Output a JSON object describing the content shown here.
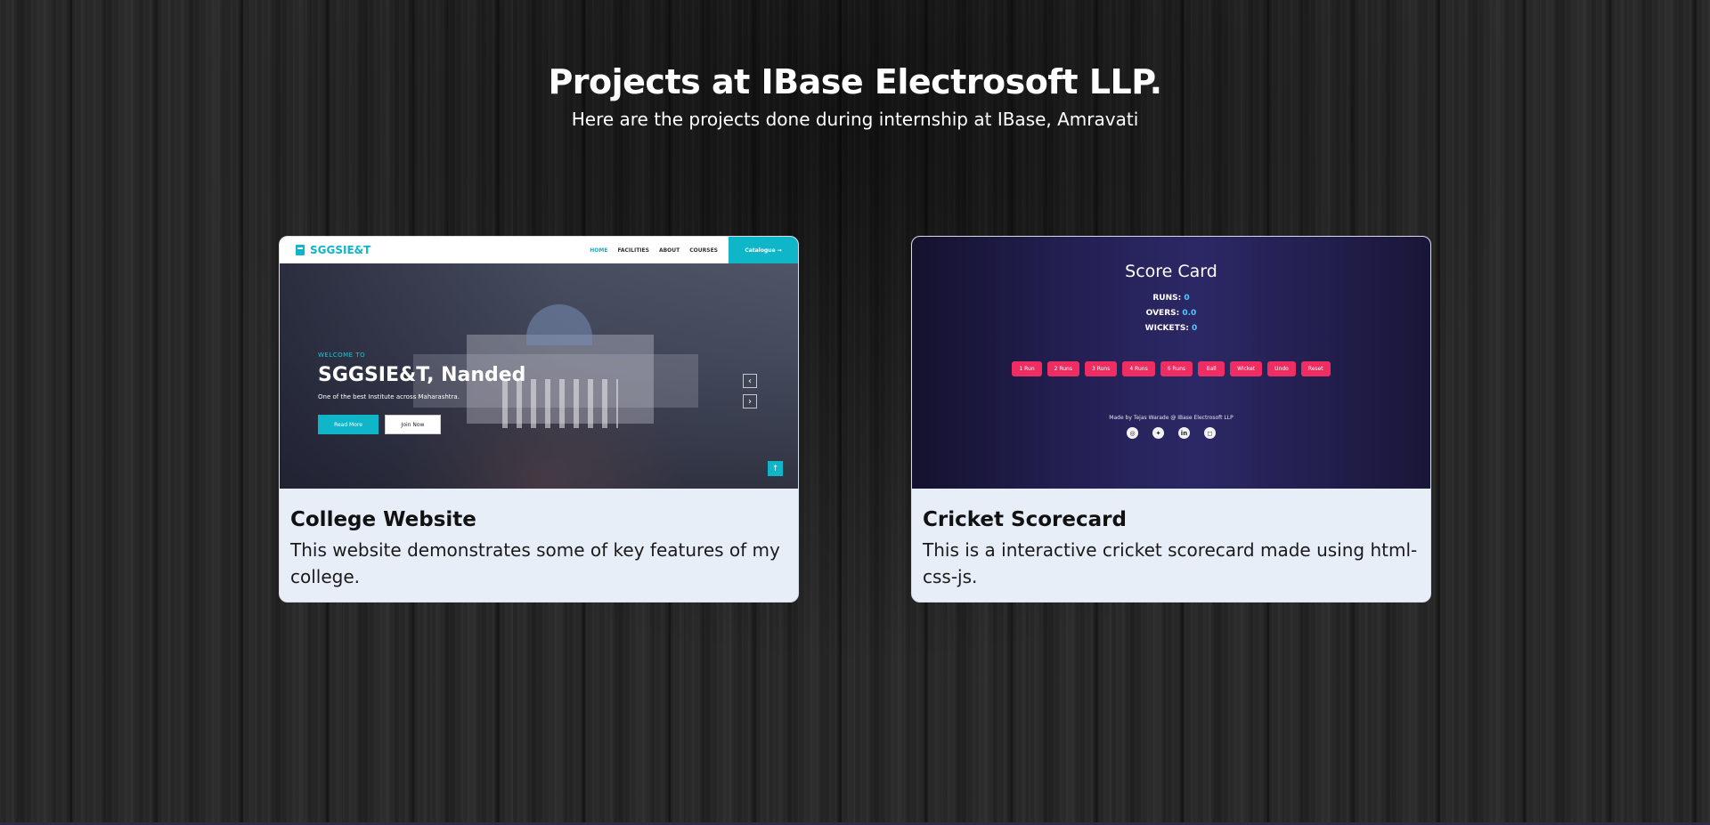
{
  "header": {
    "title": "Projects at IBase Electrosoft LLP.",
    "subtitle": "Here are the projects done during internship at IBase, Amravati"
  },
  "projects": [
    {
      "title": "College Website",
      "description": "This website demonstrates some of key features of my college.",
      "preview": {
        "logo": "SGGSIE&T",
        "menu": [
          "HOME",
          "FACILITIES",
          "ABOUT",
          "COURSES"
        ],
        "cta": "Catalogue →",
        "welcome": "WELCOME TO",
        "hero_title": "SGGSIE&T, Nanded",
        "hero_subtitle": "One of the best Institute across Maharashtra.",
        "read_more": "Read More",
        "join_now": "Join Now"
      }
    },
    {
      "title": "Cricket Scorecard",
      "description": "This is a interactive cricket scorecard made using html-css-js.",
      "preview": {
        "title": "Score Card",
        "stats": [
          {
            "label": "RUNS:",
            "value": "0"
          },
          {
            "label": "OVERS:",
            "value": "0.0"
          },
          {
            "label": "WICKETS:",
            "value": "0"
          }
        ],
        "buttons": [
          "1 Run",
          "2 Runs",
          "3 Runs",
          "4 Runs",
          "6 Runs",
          "Ball",
          "Wicket",
          "Undo",
          "Reset"
        ],
        "credit": "Made by Tejas Warade @ IBase Electrosoft LLP",
        "social": [
          "github-icon",
          "twitter-icon",
          "linkedin-icon",
          "instagram-icon"
        ]
      }
    }
  ],
  "colors": {
    "accent_teal": "#0fb5c8",
    "score_button": "#ee2e63",
    "card_bg": "#e8eef7"
  }
}
